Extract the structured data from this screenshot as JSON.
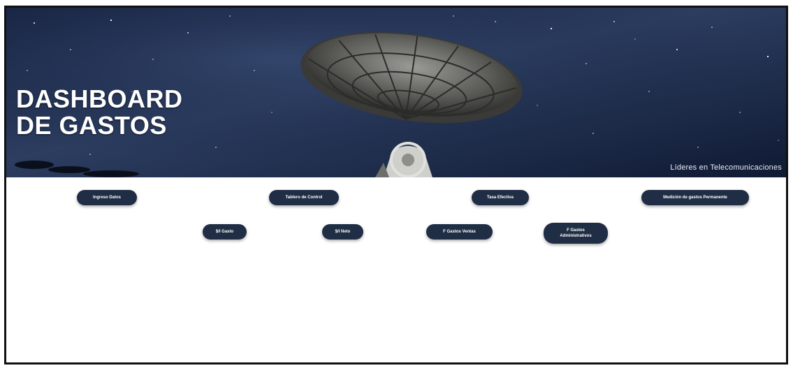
{
  "hero": {
    "title_line1": "DASHBOARD",
    "title_line2": "DE GASTOS",
    "tagline": "Líderes en Telecomunicaciones",
    "image": "satellite-dish-night-sky"
  },
  "nav": {
    "row1": [
      {
        "label": "Ingreso Datos"
      },
      {
        "label": "Tablero de Control"
      },
      {
        "label": "Tasa Efectiva"
      },
      {
        "label": "Medición de gastos Permanente"
      }
    ],
    "row2": [
      {
        "label": "$/I Gasto"
      },
      {
        "label": "$/I Neto"
      },
      {
        "label": "F Gastos Ventas"
      },
      {
        "label_line1": "F Gastos",
        "label_line2": "Administrativos"
      }
    ]
  },
  "colors": {
    "button_bg": "#1f2d45",
    "button_text": "#ffffff",
    "sky_dark": "#0f1a33",
    "sky_mid": "#2c3d60"
  }
}
